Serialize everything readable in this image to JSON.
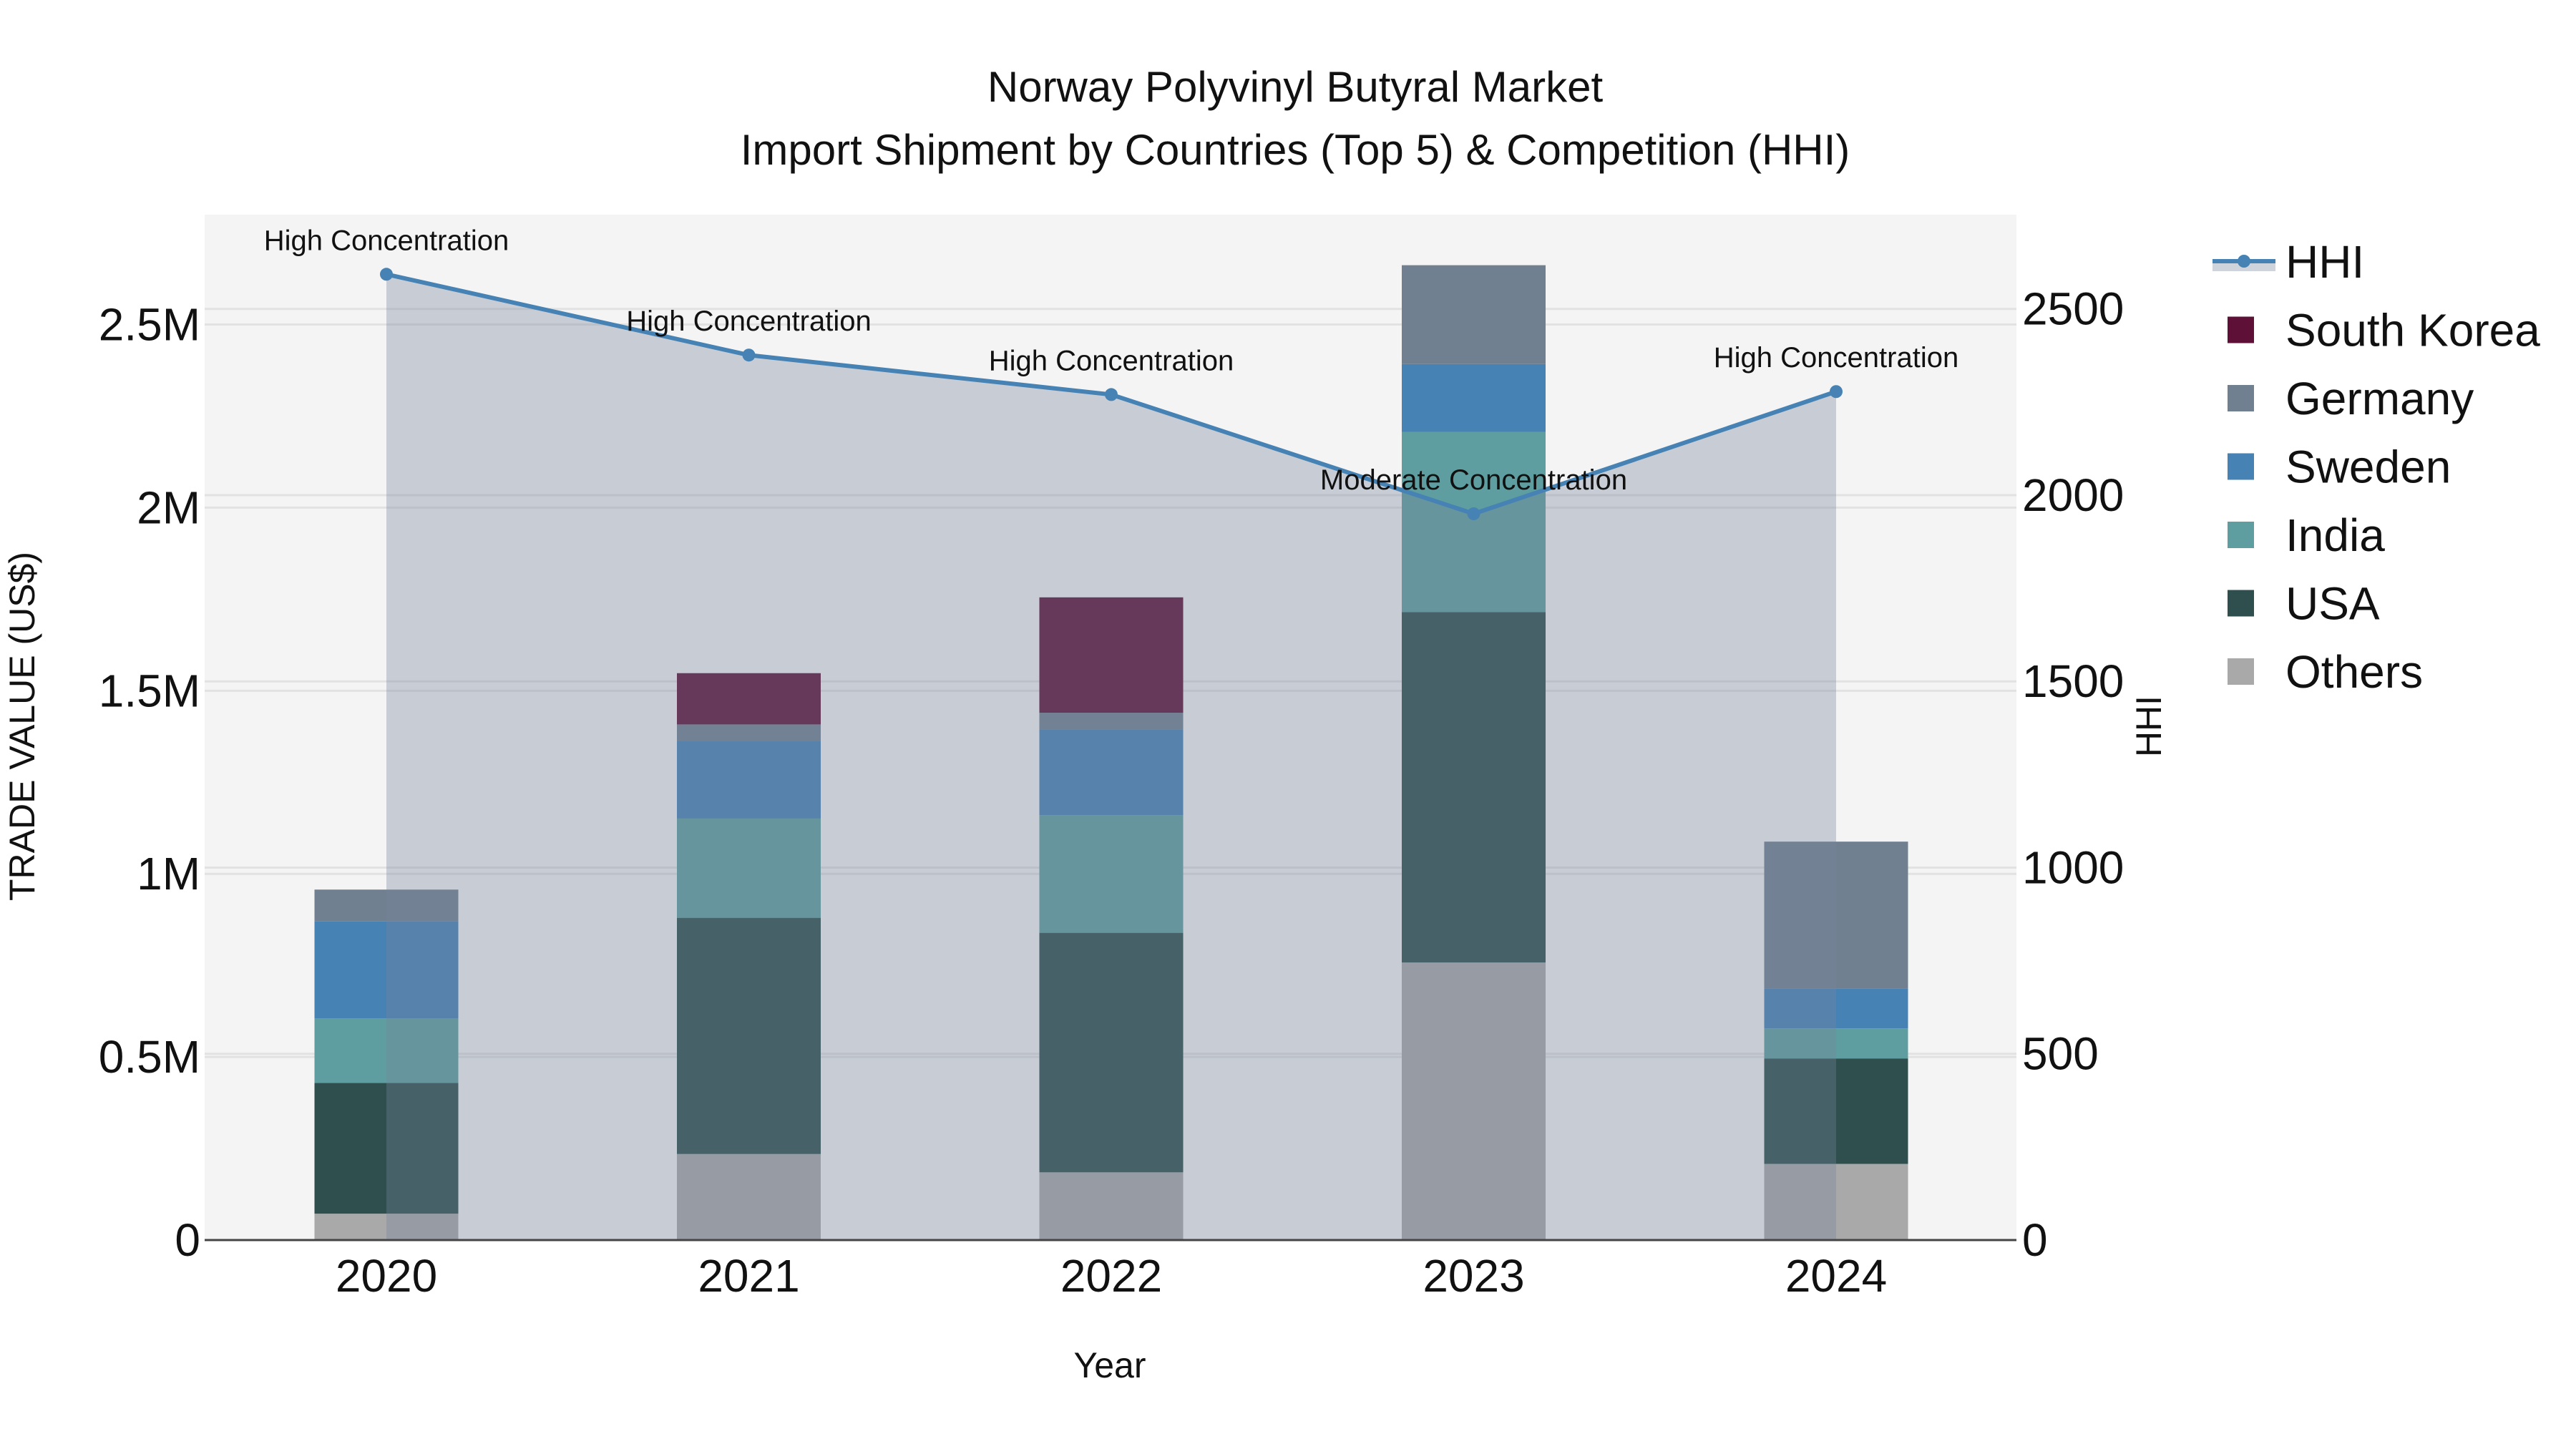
{
  "chart_data": {
    "type": "bar",
    "title_line1": "Norway Polyvinyl Butyral Market",
    "title_line2": "Import Shipment by Countries (Top 5) & Competition (HHI)",
    "xlabel": "Year",
    "ylabel": "TRADE VALUE (US$)",
    "y2label": "HHI",
    "categories": [
      "2020",
      "2021",
      "2022",
      "2023",
      "2024"
    ],
    "ylim": [
      0,
      2800000
    ],
    "y2lim": [
      0,
      2753
    ],
    "yticks": [
      {
        "v": 0,
        "label": "0"
      },
      {
        "v": 500000,
        "label": "0.5M"
      },
      {
        "v": 1000000,
        "label": "1M"
      },
      {
        "v": 1500000,
        "label": "1.5M"
      },
      {
        "v": 2000000,
        "label": "2M"
      },
      {
        "v": 2500000,
        "label": "2.5M"
      }
    ],
    "y2ticks": [
      {
        "v": 0,
        "label": "0"
      },
      {
        "v": 500,
        "label": "500"
      },
      {
        "v": 1000,
        "label": "1000"
      },
      {
        "v": 1500,
        "label": "1500"
      },
      {
        "v": 2000,
        "label": "2000"
      },
      {
        "v": 2500,
        "label": "2500"
      }
    ],
    "grid": true,
    "legend_position": "right",
    "series": [
      {
        "name": "Others",
        "color": "#a9a9a9",
        "values": [
          72000,
          235000,
          185000,
          758000,
          208000
        ]
      },
      {
        "name": "USA",
        "color": "#2f4f4f",
        "values": [
          357000,
          645000,
          654000,
          957000,
          288000
        ]
      },
      {
        "name": "India",
        "color": "#5f9ea0",
        "values": [
          176000,
          271000,
          321000,
          492000,
          82000
        ]
      },
      {
        "name": "Sweden",
        "color": "#4682b4",
        "values": [
          266000,
          212000,
          234000,
          185000,
          108000
        ]
      },
      {
        "name": "Germany",
        "color": "#708090",
        "values": [
          86000,
          45000,
          46000,
          270000,
          402000
        ]
      },
      {
        "name": "South Korea",
        "color": "#5e1037",
        "values": [
          0,
          140000,
          315000,
          0,
          0
        ]
      }
    ],
    "hhi": {
      "name": "HHI",
      "color": "#4682b4",
      "values": [
        2593,
        2376,
        2270,
        1950,
        2278
      ],
      "annotations": [
        "High Concentration",
        "High Concentration",
        "High Concentration",
        "Moderate Concentration",
        "High Concentration"
      ]
    },
    "legend_order": [
      "HHI",
      "South Korea",
      "Germany",
      "Sweden",
      "India",
      "USA",
      "Others"
    ]
  }
}
